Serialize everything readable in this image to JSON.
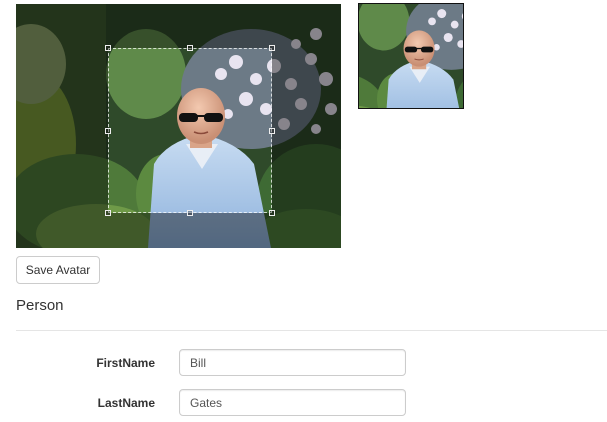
{
  "avatar": {
    "save_label": "Save Avatar"
  },
  "person": {
    "legend": "Person",
    "fields": [
      {
        "label": "FirstName",
        "value": "Bill"
      },
      {
        "label": "LastName",
        "value": "Gates"
      }
    ]
  }
}
